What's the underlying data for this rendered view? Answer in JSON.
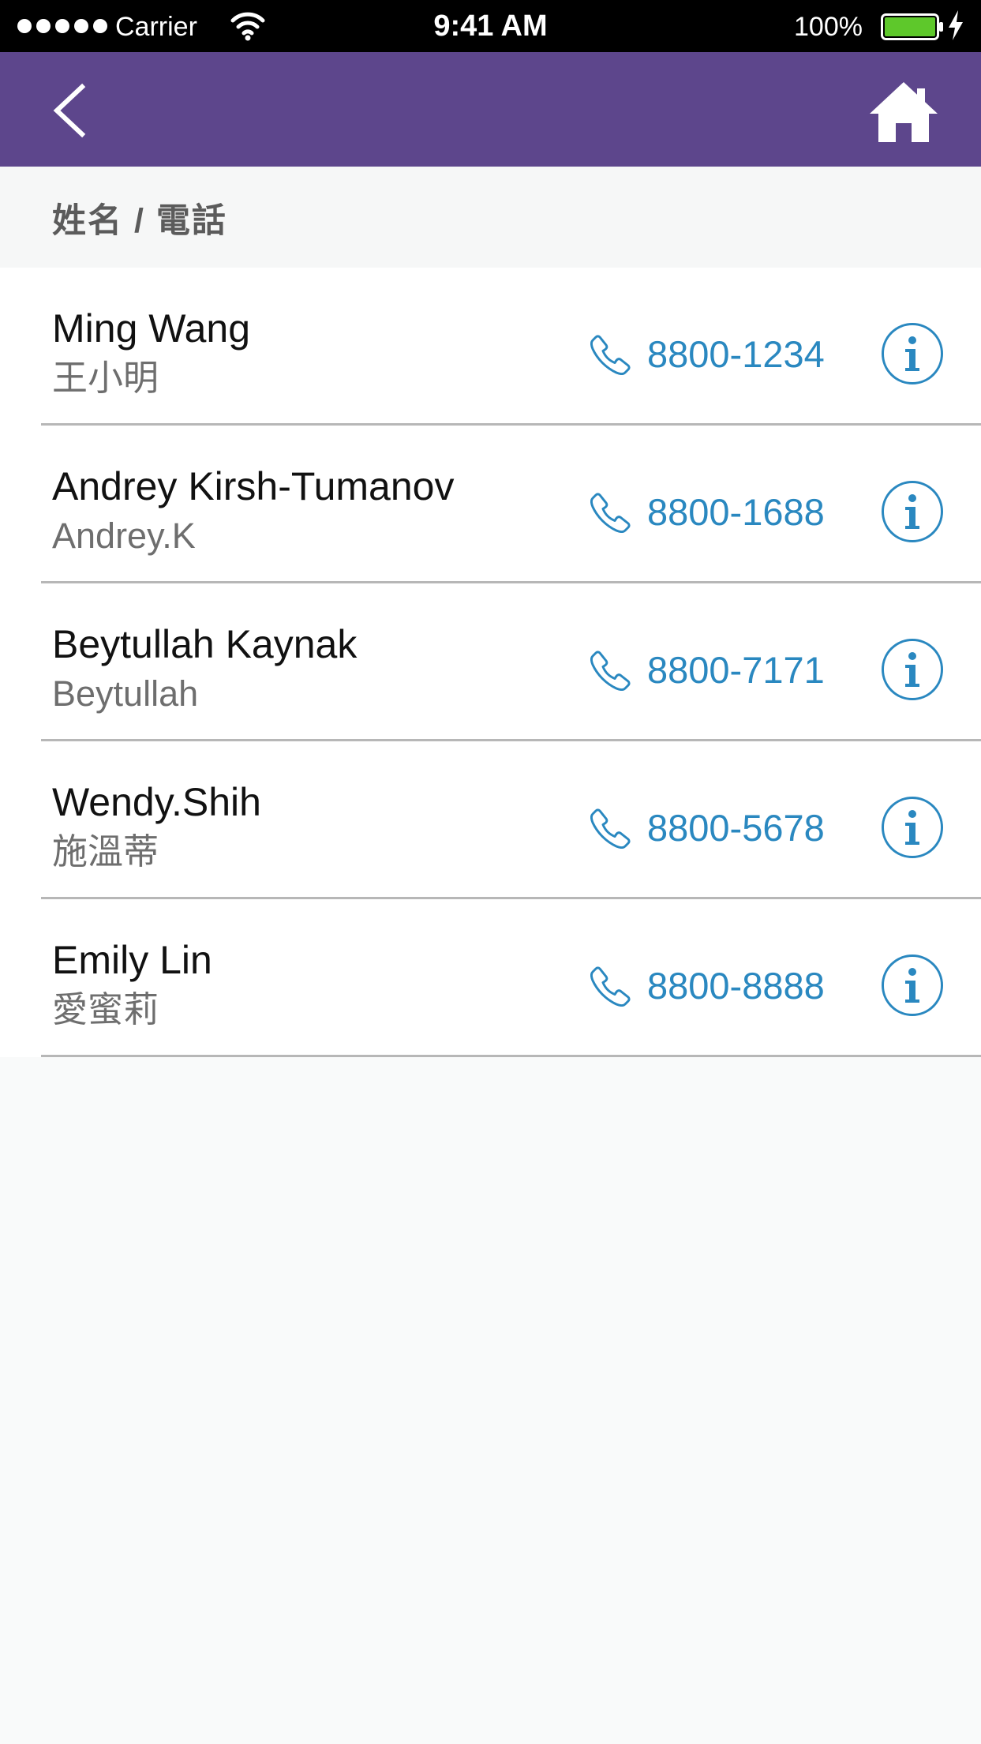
{
  "status_bar": {
    "carrier": "Carrier",
    "time": "9:41 AM",
    "battery": "100%",
    "icons": [
      "signal-icon",
      "wifi-icon",
      "battery-icon",
      "charging-bolt-icon"
    ]
  },
  "nav": {
    "back_icon": "chevron-left-icon",
    "home_icon": "home-icon",
    "background_color": "#5d468c"
  },
  "section": {
    "title": "姓名 / 電話"
  },
  "contacts": [
    {
      "name": "Ming Wang",
      "alias": "王小明",
      "phone": "8800-1234"
    },
    {
      "name": "Andrey Kirsh-Tumanov",
      "alias": "Andrey.K",
      "phone": "8800-1688"
    },
    {
      "name": "Beytullah Kaynak",
      "alias": "Beytullah",
      "phone": "8800-7171"
    },
    {
      "name": "Wendy.Shih",
      "alias": "施溫蒂",
      "phone": "8800-5678"
    },
    {
      "name": "Emily Lin",
      "alias": "愛蜜莉",
      "phone": "8800-8888"
    }
  ],
  "colors": {
    "accent": "#2a88c0",
    "nav_purple": "#5d468c",
    "battery_green": "#5ec82b",
    "divider": "#b7b7b7"
  }
}
